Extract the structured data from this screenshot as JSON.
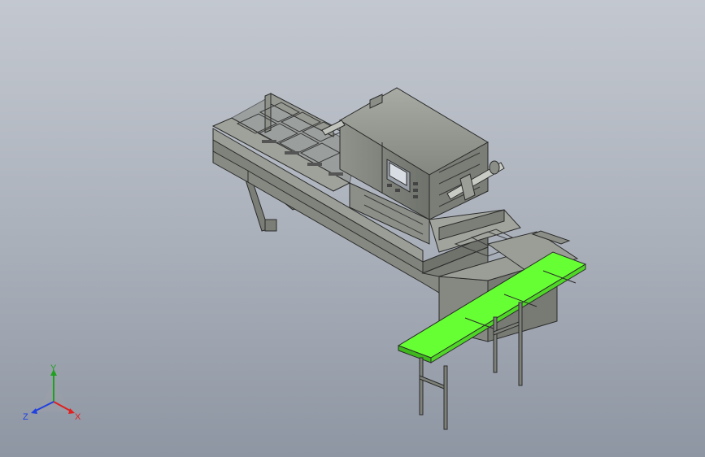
{
  "viewport": {
    "background_top": "#c3c8d0",
    "background_bottom": "#8e96a3"
  },
  "model": {
    "body_color": "#8d918a",
    "body_dark": "#6f736c",
    "body_light": "#a7aba3",
    "conveyor_belt_color": "#66ff33",
    "edge_color": "#2b2b2b"
  },
  "triad": {
    "x_label": "X",
    "y_label": "Y",
    "z_label": "Z",
    "x_color": "#e02020",
    "y_color": "#20a020",
    "z_color": "#2040e0"
  }
}
